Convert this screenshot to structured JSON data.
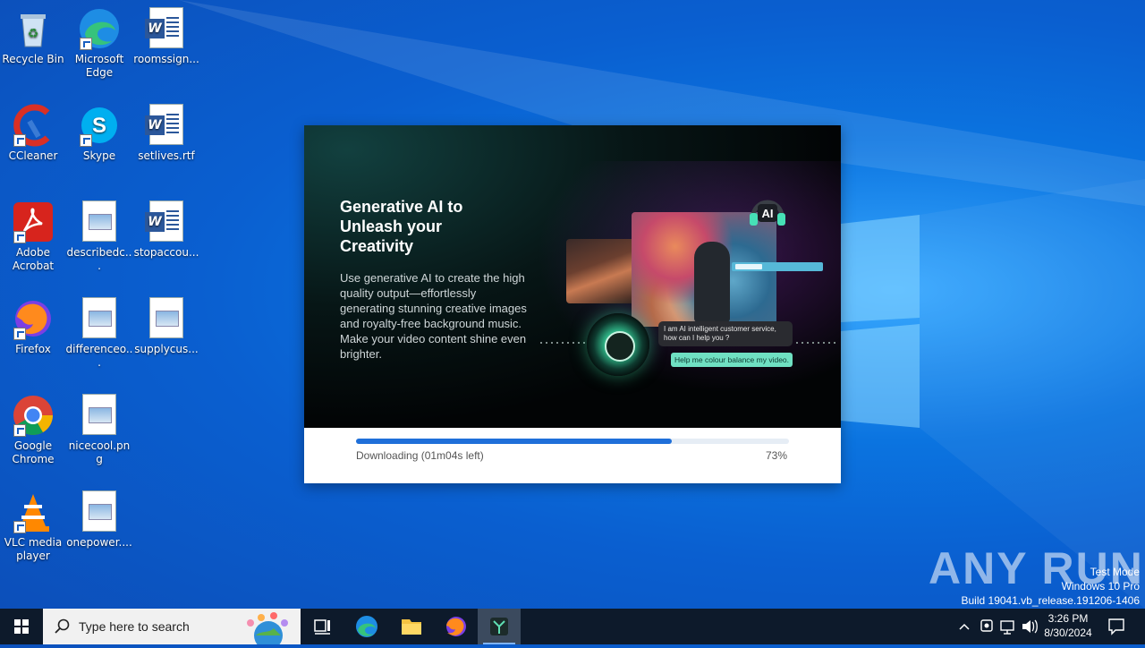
{
  "desktop": {
    "icons": [
      {
        "label": "Recycle Bin"
      },
      {
        "label": "Microsoft Edge"
      },
      {
        "label": "roomssign..."
      },
      {
        "label": "CCleaner"
      },
      {
        "label": "Skype"
      },
      {
        "label": "setlives.rtf"
      },
      {
        "label": "Adobe Acrobat"
      },
      {
        "label": "describedc..."
      },
      {
        "label": "stopaccou..."
      },
      {
        "label": "Firefox"
      },
      {
        "label": "differenceo..."
      },
      {
        "label": "supplycus..."
      },
      {
        "label": "Google Chrome"
      },
      {
        "label": "nicecool.png"
      },
      {
        "label": "VLC media player"
      },
      {
        "label": "onepower...."
      }
    ]
  },
  "installer": {
    "banner_title": "Generative AI to Unleash your Creativity",
    "banner_body": "Use generative AI to create the high quality output—effortlessly generating stunning creative images and royalty-free background music. Make your video content shine even brighter.",
    "ai_badge": "AI",
    "chat_ai": "I am AI intelligent customer service, how can I help you ?",
    "chat_user": "Help me colour balance my video.",
    "status": "Downloading (01m04s left)",
    "percent_label": "73%",
    "progress_fraction": 0.73,
    "accent_color": "#1f6fd9"
  },
  "watermark": {
    "brand": "ANY RUN",
    "line1": "Test Mode",
    "line2": "Windows 10 Pro",
    "line3": "Build 19041.vb_release.191206-1406"
  },
  "taskbar": {
    "search_placeholder": "Type here to search",
    "time": "3:26 PM",
    "date": "8/30/2024"
  }
}
